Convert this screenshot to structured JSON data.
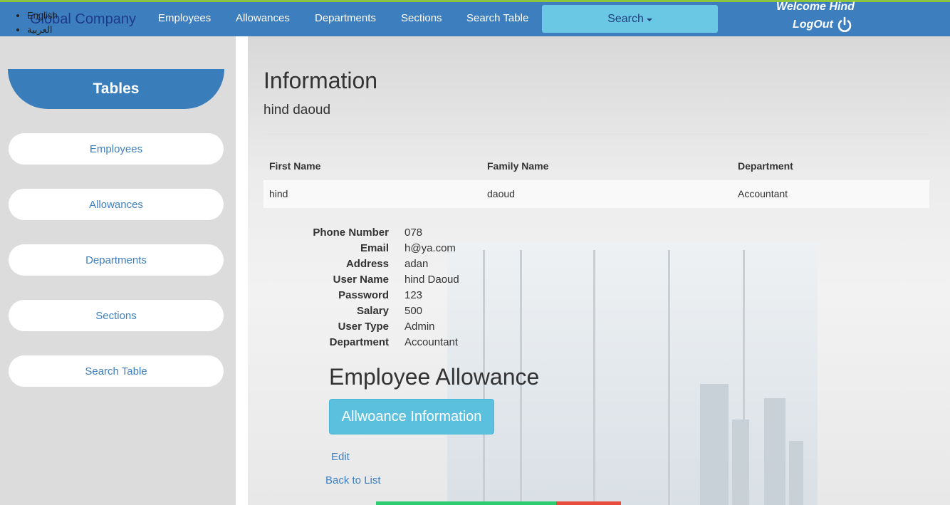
{
  "languages": [
    "English",
    "العربية"
  ],
  "brand": "Global Company",
  "nav": {
    "employees": "Employees",
    "allowances": "Allowances",
    "departments": "Departments",
    "sections": "Sections",
    "search_table": "Search Table",
    "search": "Search"
  },
  "user": {
    "welcome": "Welcome Hind",
    "logout": "LogOut"
  },
  "sidebar": {
    "heading": "Tables",
    "items": [
      "Employees",
      "Allowances",
      "Departments",
      "Sections",
      "Search Table"
    ]
  },
  "main": {
    "title": "Information",
    "subtitle": "hind daoud",
    "table": {
      "headers": [
        "First Name",
        "Family Name",
        "Department"
      ],
      "row": [
        "hind",
        "daoud",
        "Accountant"
      ]
    },
    "details": [
      {
        "label": "Phone Number",
        "value": "078"
      },
      {
        "label": "Email",
        "value": "h@ya.com"
      },
      {
        "label": "Address",
        "value": "adan"
      },
      {
        "label": "User Name",
        "value": "hind Daoud"
      },
      {
        "label": "Password",
        "value": "123"
      },
      {
        "label": "Salary",
        "value": "500"
      },
      {
        "label": "User Type",
        "value": "Admin"
      },
      {
        "label": "Department",
        "value": "Accountant"
      }
    ],
    "allowance_heading": "Employee Allowance",
    "allowance_button": "Allwoance Information",
    "edit_link": "Edit",
    "back_link": "Back to List"
  },
  "colors": {
    "navbar": "#3d7ebf",
    "accent": "#5bc0de",
    "topline": "#8cc63f",
    "link": "#3f7fbf"
  }
}
